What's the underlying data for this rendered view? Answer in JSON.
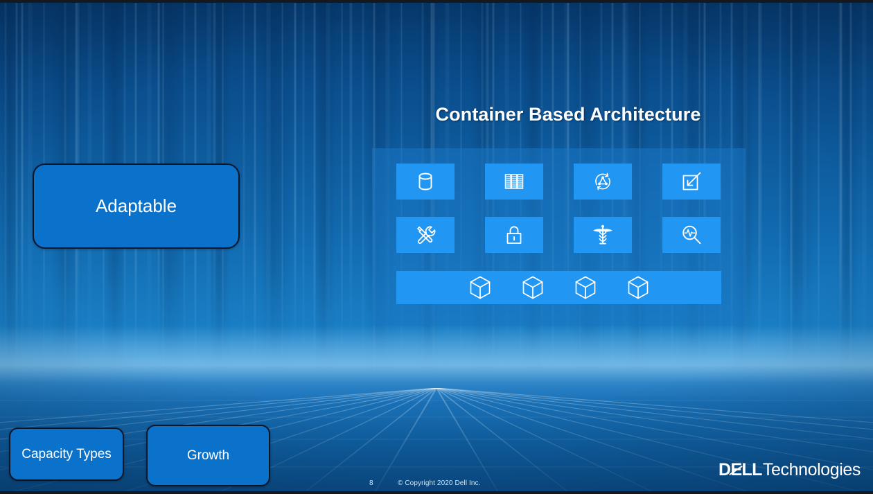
{
  "slide": {
    "title": "Container Based Architecture",
    "page_number": "8",
    "copyright": "© Copyright 2020 Dell Inc.",
    "brand": {
      "mark_d": "D",
      "mark_e": "E",
      "mark_ll": "LL",
      "suffix": "Technologies"
    },
    "colors": {
      "background_deep": "#06386b",
      "background_mid": "#1169ae",
      "panel_fill": "#1a77c3",
      "tile_fill": "#2196f3",
      "button_fill": "#0b72cc",
      "button_border": "#0c1626",
      "text": "#ffffff",
      "footer_text": "#cfe6f8",
      "letterbox": "#15191e"
    }
  },
  "nav_buttons": [
    {
      "id": "adaptable",
      "label": "Adaptable"
    },
    {
      "id": "capacity-types",
      "label": "Capacity Types"
    },
    {
      "id": "growth",
      "label": "Growth"
    }
  ],
  "architecture_panel": {
    "icons": [
      {
        "name": "database-icon",
        "label": "Database"
      },
      {
        "name": "server-rack-icon",
        "label": "Server Rack"
      },
      {
        "name": "network-sync-icon",
        "label": "Network Sync"
      },
      {
        "name": "scale-in-icon",
        "label": "Scale In"
      },
      {
        "name": "tools-icon",
        "label": "Tools"
      },
      {
        "name": "lock-icon",
        "label": "Security Lock"
      },
      {
        "name": "caduceus-icon",
        "label": "Health"
      },
      {
        "name": "magnifier-pulse-icon",
        "label": "Monitoring"
      }
    ],
    "containers": [
      {
        "name": "container-cube-icon",
        "label": "Container 1"
      },
      {
        "name": "container-cube-icon",
        "label": "Container 2"
      },
      {
        "name": "container-cube-icon",
        "label": "Container 3"
      },
      {
        "name": "container-cube-icon",
        "label": "Container 4"
      }
    ]
  }
}
